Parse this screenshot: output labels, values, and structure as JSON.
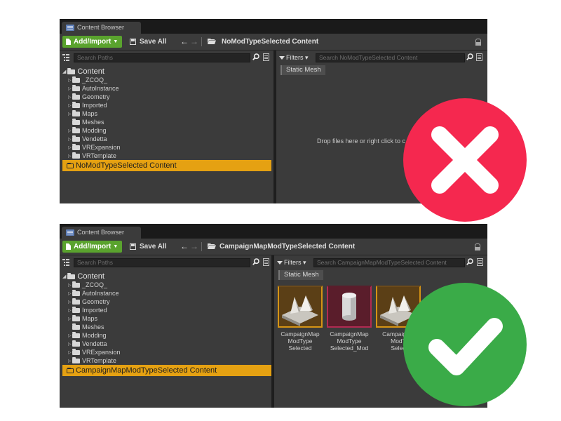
{
  "top_panel": {
    "tab_title": "Content Browser",
    "add_import_label": "Add/Import",
    "save_all_label": "Save All",
    "current_path": "NoModTypeSelected Content",
    "search_paths_placeholder": "Search Paths",
    "filters_label": "Filters",
    "search_assets_placeholder": "Search NoModTypeSelected Content",
    "active_filter_chip": "Static Mesh",
    "tree_root": "Content",
    "tree_items": [
      {
        "label": "_ZCOQ_",
        "expandable": true
      },
      {
        "label": "AutoInstance",
        "expandable": true
      },
      {
        "label": "Geometry",
        "expandable": true
      },
      {
        "label": "Imported",
        "expandable": true
      },
      {
        "label": "Maps",
        "expandable": true
      },
      {
        "label": "Meshes",
        "expandable": false
      },
      {
        "label": "Modding",
        "expandable": true
      },
      {
        "label": "Vendetta",
        "expandable": true
      },
      {
        "label": "VRExpansion",
        "expandable": true
      },
      {
        "label": "VRTemplate",
        "expandable": true
      }
    ],
    "selected_folder": "NoModTypeSelected Content",
    "empty_message": "Drop files here or right click to c"
  },
  "bottom_panel": {
    "tab_title": "Content Browser",
    "add_import_label": "Add/Import",
    "save_all_label": "Save All",
    "current_path": "CampaignMapModTypeSelected Content",
    "search_paths_placeholder": "Search Paths",
    "filters_label": "Filters",
    "search_assets_placeholder": "Search CampaignMapModTypeSelected Content",
    "active_filter_chip": "Static Mesh",
    "tree_root": "Content",
    "tree_items": [
      {
        "label": "_ZCOQ_",
        "expandable": true
      },
      {
        "label": "AutoInstance",
        "expandable": true
      },
      {
        "label": "Geometry",
        "expandable": true
      },
      {
        "label": "Imported",
        "expandable": true
      },
      {
        "label": "Maps",
        "expandable": true
      },
      {
        "label": "Meshes",
        "expandable": false
      },
      {
        "label": "Modding",
        "expandable": true
      },
      {
        "label": "Vendetta",
        "expandable": true
      },
      {
        "label": "VRExpansion",
        "expandable": true
      },
      {
        "label": "VRTemplate",
        "expandable": true
      }
    ],
    "selected_folder": "CampaignMapModTypeSelected Content",
    "assets": [
      {
        "type": "static-mesh",
        "label_lines": [
          "CampaignMap",
          "ModType",
          "Selected"
        ]
      },
      {
        "type": "mod-asset",
        "label_lines": [
          "CampaignMap",
          "ModType",
          "Selected_Mod"
        ]
      },
      {
        "type": "static-mesh",
        "label_lines": [
          "CampaignM",
          "ModT",
          "Selec"
        ]
      }
    ]
  },
  "badges": {
    "wrong": {
      "icon": "cross-icon",
      "color": "#f5284f"
    },
    "correct": {
      "icon": "checkmark-icon",
      "color": "#3aab48"
    }
  },
  "colors": {
    "selection": "#e5a112",
    "add_button": "#5aa32e",
    "panel_bg": "#3b3b3b"
  }
}
